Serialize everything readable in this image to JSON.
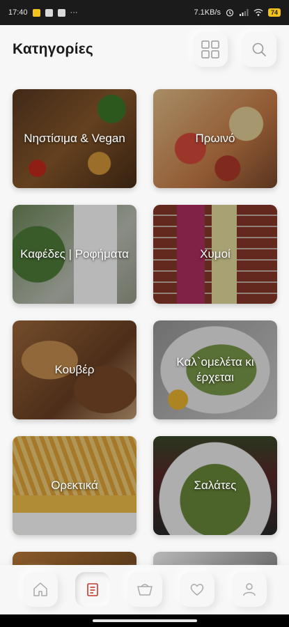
{
  "status_bar": {
    "time": "17:40",
    "dots": "···",
    "speed": "7.1KB/s",
    "battery": "74"
  },
  "header": {
    "title": "Κατηγορίες"
  },
  "categories": [
    {
      "label": "Νηστίσιμα & Vegan"
    },
    {
      "label": "Πρωινό"
    },
    {
      "label": "Καφέδες | Ροφήματα"
    },
    {
      "label": "Χυμοί"
    },
    {
      "label": "Κουβέρ"
    },
    {
      "label": "Καλ`ομελέτα κι έρχεται"
    },
    {
      "label": "Ορεκτικά"
    },
    {
      "label": "Σαλάτες"
    }
  ],
  "bottom_nav": {
    "items": [
      {
        "icon": "home-icon"
      },
      {
        "icon": "menu-icon",
        "active": true
      },
      {
        "icon": "basket-icon"
      },
      {
        "icon": "heart-icon"
      },
      {
        "icon": "user-icon"
      }
    ],
    "active_color": "#c0392b"
  }
}
